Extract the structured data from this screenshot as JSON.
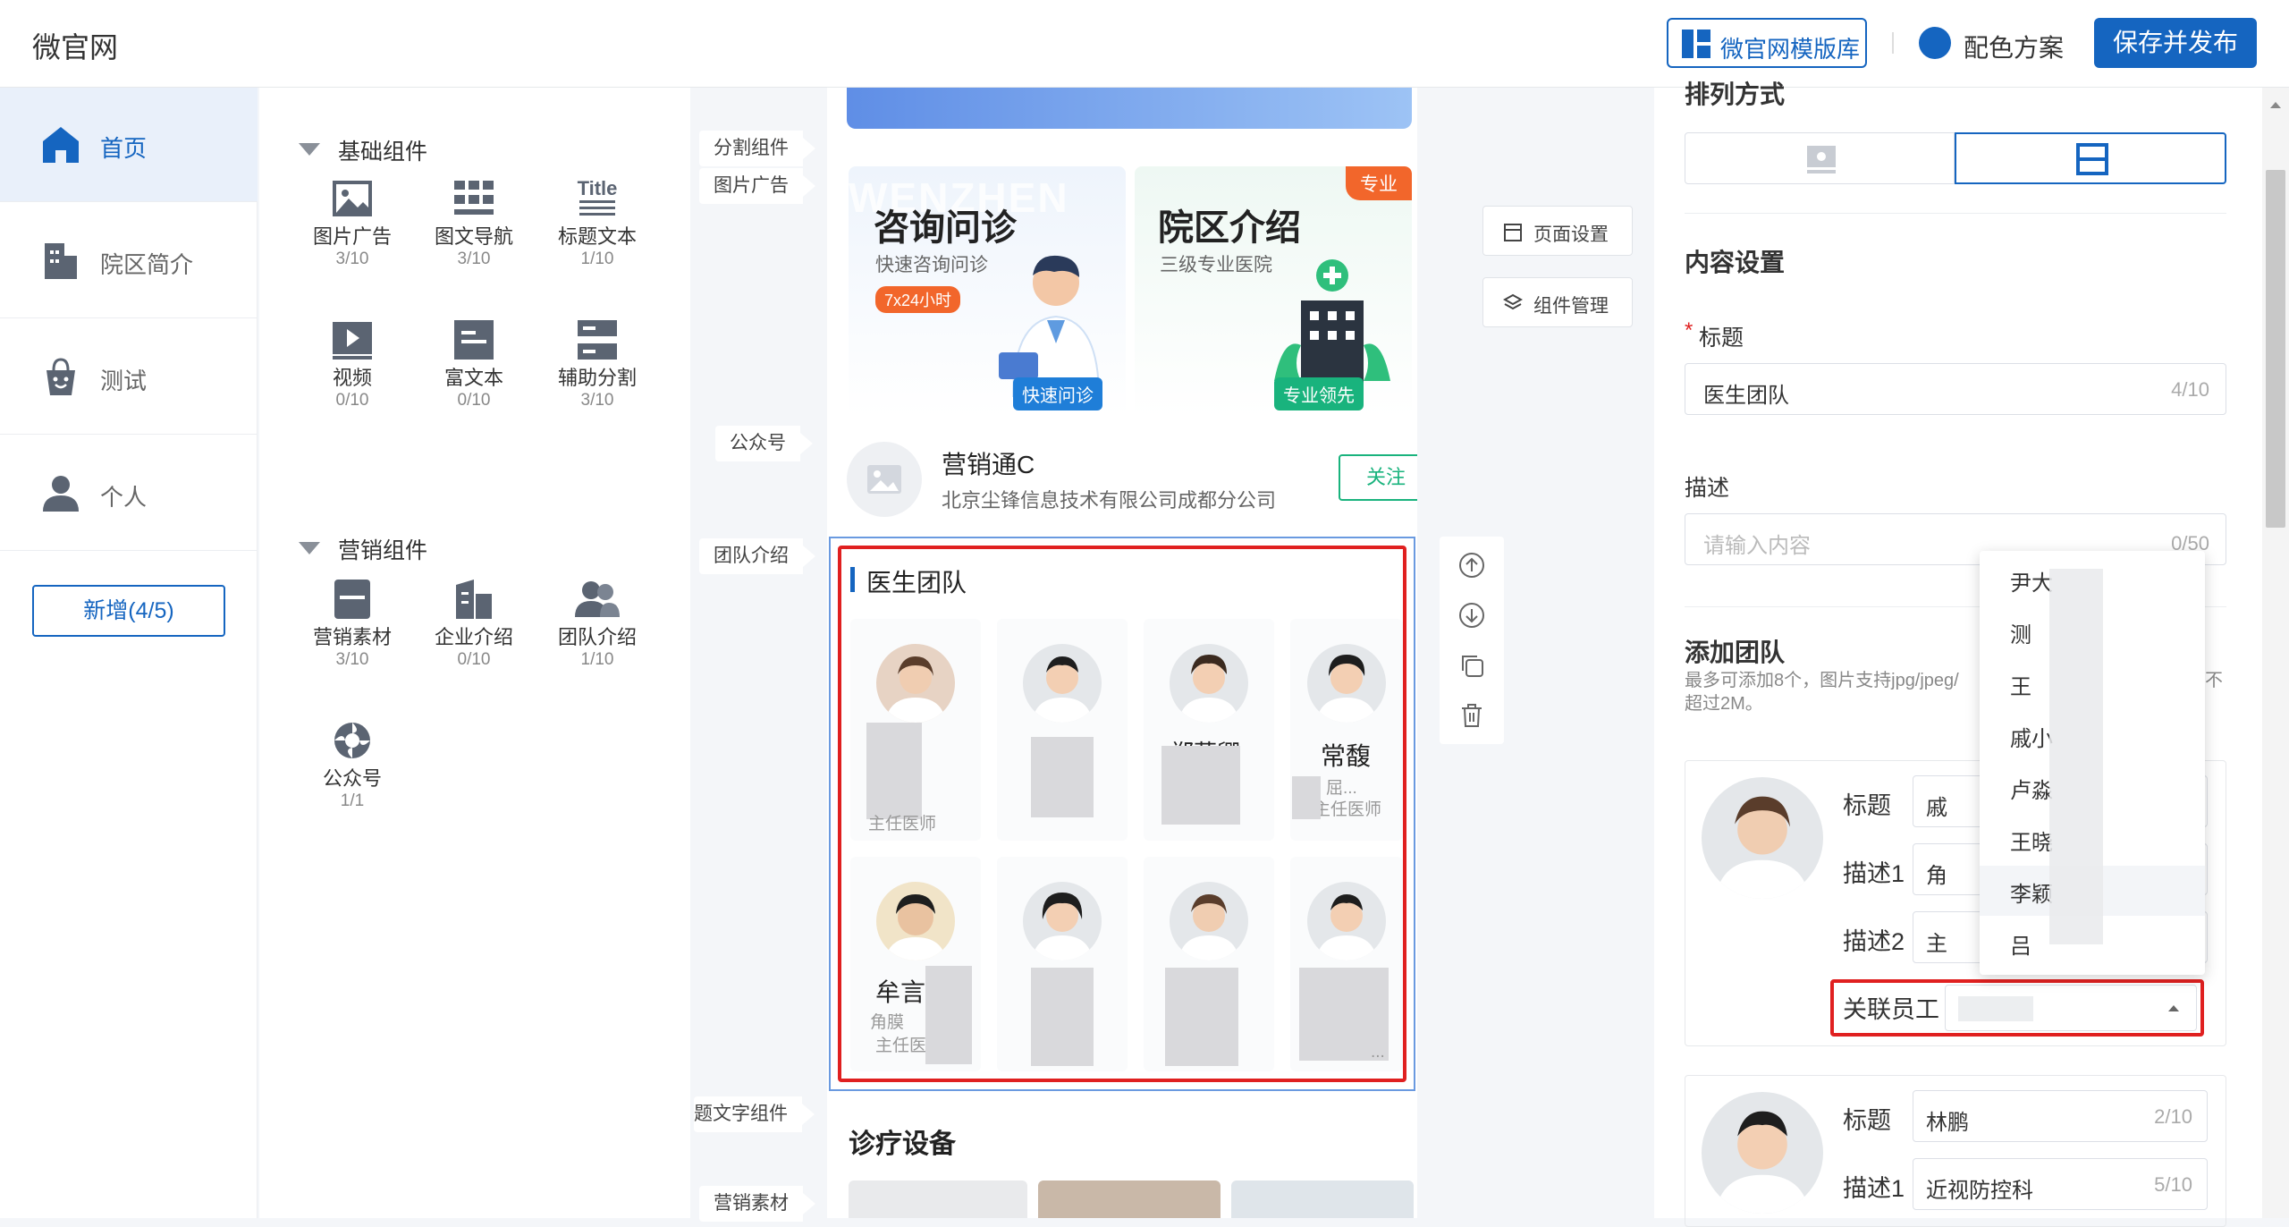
{
  "app": {
    "title": "微官网"
  },
  "header": {
    "template_btn": "微官网模版库",
    "color_scheme": "配色方案",
    "publish_btn": "保存并发布"
  },
  "leftnav": {
    "items": [
      {
        "label": "首页",
        "icon": "home-icon",
        "active": true
      },
      {
        "label": "院区简介",
        "icon": "building-icon",
        "active": false
      },
      {
        "label": "测试",
        "icon": "shopping-bag-icon",
        "active": false
      },
      {
        "label": "个人",
        "icon": "person-icon",
        "active": false
      }
    ],
    "add_btn": "新增(4/5)"
  },
  "components": {
    "basic_title": "基础组件",
    "basic": [
      {
        "name": "图片广告",
        "count": "3/10",
        "icon": "image-icon"
      },
      {
        "name": "图文导航",
        "count": "3/10",
        "icon": "grid-nav-icon"
      },
      {
        "name": "标题文本",
        "count": "1/10",
        "icon": "title-text-icon"
      },
      {
        "name": "视频",
        "count": "0/10",
        "icon": "video-icon"
      },
      {
        "name": "富文本",
        "count": "0/10",
        "icon": "rich-text-icon"
      },
      {
        "name": "辅助分割",
        "count": "3/10",
        "icon": "divider-icon"
      }
    ],
    "marketing_title": "营销组件",
    "marketing": [
      {
        "name": "营销素材",
        "count": "3/10",
        "icon": "material-icon"
      },
      {
        "name": "企业介绍",
        "count": "0/10",
        "icon": "company-icon"
      },
      {
        "name": "团队介绍",
        "count": "1/10",
        "icon": "team-icon"
      },
      {
        "name": "公众号",
        "count": "1/1",
        "icon": "official-account-icon"
      }
    ]
  },
  "canvas": {
    "tags": [
      "分割组件",
      "图片广告",
      "公众号",
      "团队介绍",
      "题文字组件",
      "营销素材"
    ],
    "cards": [
      {
        "title": "咨询问诊",
        "subtitle": "快速咨询问诊",
        "badge": "7x24小时",
        "cta": "快速问诊",
        "watermark": "WENZHEN"
      },
      {
        "title": "院区介绍",
        "subtitle": "三级专业医院",
        "ribbon": "专业",
        "cta": "专业领先"
      }
    ],
    "account": {
      "name": "营销通C",
      "company": "北京尘锋信息技术有限公司成都分公司",
      "follow": "关注"
    },
    "team": {
      "title": "医生团队",
      "doctors": [
        {
          "name": "",
          "desc": "主任医师"
        },
        {
          "name": "",
          "desc": ""
        },
        {
          "name": "郑菲卿",
          "desc": ""
        },
        {
          "name": "常馥",
          "desc": "屈...",
          "desc2": "主任医师"
        },
        {
          "name": "牟言",
          "desc": "角膜",
          "desc2": "主任医"
        },
        {
          "name": "",
          "desc": ""
        },
        {
          "name": "",
          "desc": ""
        },
        {
          "name": "",
          "desc": "..."
        }
      ]
    },
    "next_section": "诊疗设备",
    "side_buttons": {
      "page_settings": "页面设置",
      "component_mgmt": "组件管理"
    }
  },
  "settings": {
    "layout_label": "排列方式",
    "content_title": "内容设置",
    "title_label": "标题",
    "title_value": "医生团队",
    "title_count": "4/10",
    "desc_label": "描述",
    "desc_placeholder": "请输入内容",
    "desc_count": "0/50",
    "add_team_title": "添加团队",
    "add_team_hint": "最多可添加8个，图片支持jpg/jpeg/",
    "add_team_hint2": "超过2M。",
    "add_team_hint_tail": "不",
    "member1": {
      "title_label": "标题",
      "title_value": "戚",
      "desc1_label": "描述1",
      "desc1_value": "角",
      "desc2_label": "描述2",
      "desc2_value": "主",
      "link_label": "关联员工"
    },
    "member2": {
      "title_label": "标题",
      "title_value": "林鹏",
      "title_count": "2/10",
      "desc1_label": "描述1",
      "desc1_value": "近视防控科",
      "desc1_count": "5/10"
    },
    "dropdown": [
      "尹大",
      "测",
      "王",
      "戚小",
      "卢淼",
      "王晓",
      "李颖",
      "吕"
    ]
  },
  "colors": {
    "accent": "#1565c0",
    "highlight": "#e02020",
    "green": "#19b37d",
    "orange": "#f2662b"
  }
}
